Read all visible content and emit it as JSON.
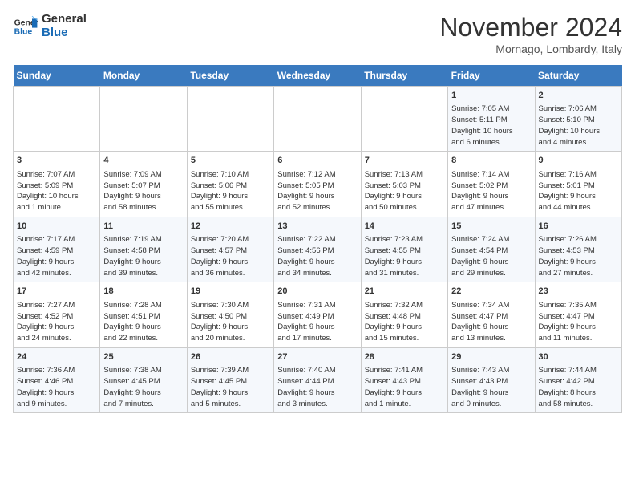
{
  "logo": {
    "line1": "General",
    "line2": "Blue"
  },
  "title": "November 2024",
  "location": "Mornago, Lombardy, Italy",
  "weekdays": [
    "Sunday",
    "Monday",
    "Tuesday",
    "Wednesday",
    "Thursday",
    "Friday",
    "Saturday"
  ],
  "weeks": [
    [
      {
        "day": "",
        "info": ""
      },
      {
        "day": "",
        "info": ""
      },
      {
        "day": "",
        "info": ""
      },
      {
        "day": "",
        "info": ""
      },
      {
        "day": "",
        "info": ""
      },
      {
        "day": "1",
        "info": "Sunrise: 7:05 AM\nSunset: 5:11 PM\nDaylight: 10 hours\nand 6 minutes."
      },
      {
        "day": "2",
        "info": "Sunrise: 7:06 AM\nSunset: 5:10 PM\nDaylight: 10 hours\nand 4 minutes."
      }
    ],
    [
      {
        "day": "3",
        "info": "Sunrise: 7:07 AM\nSunset: 5:09 PM\nDaylight: 10 hours\nand 1 minute."
      },
      {
        "day": "4",
        "info": "Sunrise: 7:09 AM\nSunset: 5:07 PM\nDaylight: 9 hours\nand 58 minutes."
      },
      {
        "day": "5",
        "info": "Sunrise: 7:10 AM\nSunset: 5:06 PM\nDaylight: 9 hours\nand 55 minutes."
      },
      {
        "day": "6",
        "info": "Sunrise: 7:12 AM\nSunset: 5:05 PM\nDaylight: 9 hours\nand 52 minutes."
      },
      {
        "day": "7",
        "info": "Sunrise: 7:13 AM\nSunset: 5:03 PM\nDaylight: 9 hours\nand 50 minutes."
      },
      {
        "day": "8",
        "info": "Sunrise: 7:14 AM\nSunset: 5:02 PM\nDaylight: 9 hours\nand 47 minutes."
      },
      {
        "day": "9",
        "info": "Sunrise: 7:16 AM\nSunset: 5:01 PM\nDaylight: 9 hours\nand 44 minutes."
      }
    ],
    [
      {
        "day": "10",
        "info": "Sunrise: 7:17 AM\nSunset: 4:59 PM\nDaylight: 9 hours\nand 42 minutes."
      },
      {
        "day": "11",
        "info": "Sunrise: 7:19 AM\nSunset: 4:58 PM\nDaylight: 9 hours\nand 39 minutes."
      },
      {
        "day": "12",
        "info": "Sunrise: 7:20 AM\nSunset: 4:57 PM\nDaylight: 9 hours\nand 36 minutes."
      },
      {
        "day": "13",
        "info": "Sunrise: 7:22 AM\nSunset: 4:56 PM\nDaylight: 9 hours\nand 34 minutes."
      },
      {
        "day": "14",
        "info": "Sunrise: 7:23 AM\nSunset: 4:55 PM\nDaylight: 9 hours\nand 31 minutes."
      },
      {
        "day": "15",
        "info": "Sunrise: 7:24 AM\nSunset: 4:54 PM\nDaylight: 9 hours\nand 29 minutes."
      },
      {
        "day": "16",
        "info": "Sunrise: 7:26 AM\nSunset: 4:53 PM\nDaylight: 9 hours\nand 27 minutes."
      }
    ],
    [
      {
        "day": "17",
        "info": "Sunrise: 7:27 AM\nSunset: 4:52 PM\nDaylight: 9 hours\nand 24 minutes."
      },
      {
        "day": "18",
        "info": "Sunrise: 7:28 AM\nSunset: 4:51 PM\nDaylight: 9 hours\nand 22 minutes."
      },
      {
        "day": "19",
        "info": "Sunrise: 7:30 AM\nSunset: 4:50 PM\nDaylight: 9 hours\nand 20 minutes."
      },
      {
        "day": "20",
        "info": "Sunrise: 7:31 AM\nSunset: 4:49 PM\nDaylight: 9 hours\nand 17 minutes."
      },
      {
        "day": "21",
        "info": "Sunrise: 7:32 AM\nSunset: 4:48 PM\nDaylight: 9 hours\nand 15 minutes."
      },
      {
        "day": "22",
        "info": "Sunrise: 7:34 AM\nSunset: 4:47 PM\nDaylight: 9 hours\nand 13 minutes."
      },
      {
        "day": "23",
        "info": "Sunrise: 7:35 AM\nSunset: 4:47 PM\nDaylight: 9 hours\nand 11 minutes."
      }
    ],
    [
      {
        "day": "24",
        "info": "Sunrise: 7:36 AM\nSunset: 4:46 PM\nDaylight: 9 hours\nand 9 minutes."
      },
      {
        "day": "25",
        "info": "Sunrise: 7:38 AM\nSunset: 4:45 PM\nDaylight: 9 hours\nand 7 minutes."
      },
      {
        "day": "26",
        "info": "Sunrise: 7:39 AM\nSunset: 4:45 PM\nDaylight: 9 hours\nand 5 minutes."
      },
      {
        "day": "27",
        "info": "Sunrise: 7:40 AM\nSunset: 4:44 PM\nDaylight: 9 hours\nand 3 minutes."
      },
      {
        "day": "28",
        "info": "Sunrise: 7:41 AM\nSunset: 4:43 PM\nDaylight: 9 hours\nand 1 minute."
      },
      {
        "day": "29",
        "info": "Sunrise: 7:43 AM\nSunset: 4:43 PM\nDaylight: 9 hours\nand 0 minutes."
      },
      {
        "day": "30",
        "info": "Sunrise: 7:44 AM\nSunset: 4:42 PM\nDaylight: 8 hours\nand 58 minutes."
      }
    ]
  ]
}
